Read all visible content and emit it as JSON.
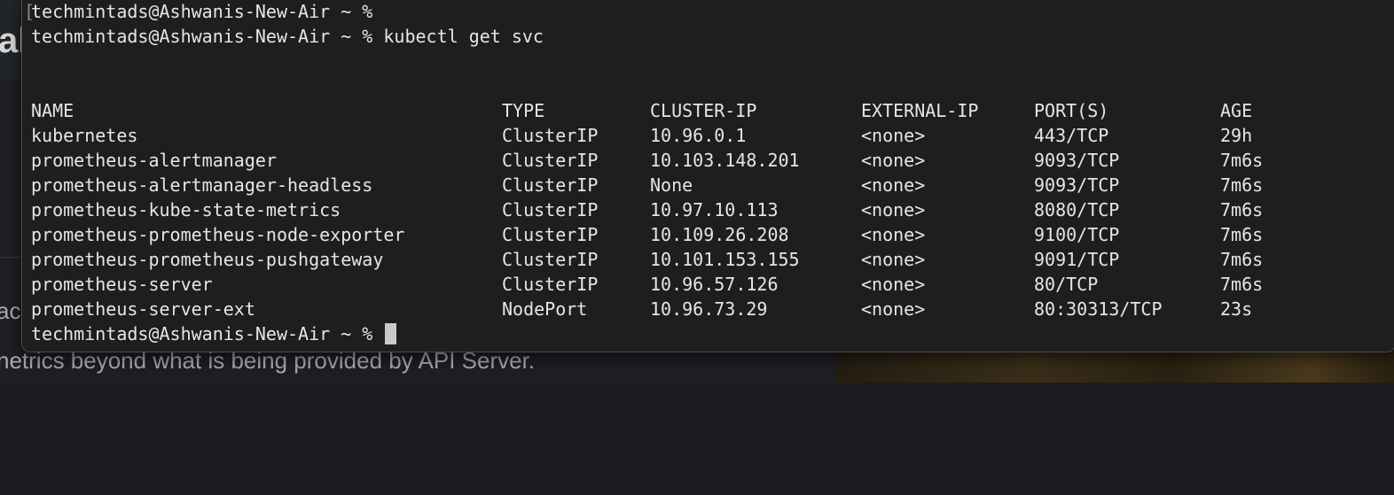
{
  "background": {
    "heading_fragment": "al",
    "text_fragment_1": "ac",
    "text_fragment_2": "netrics beyond what is being provided by API Server."
  },
  "terminal": {
    "bracket": "[",
    "prompt": "techmintads@Ashwanis-New-Air ~ %",
    "command": "kubectl get svc",
    "headers": {
      "name": "NAME",
      "type": "TYPE",
      "cluster_ip": "CLUSTER-IP",
      "external_ip": "EXTERNAL-IP",
      "ports": "PORT(S)",
      "age": "AGE"
    },
    "rows": [
      {
        "name": "kubernetes",
        "type": "ClusterIP",
        "cluster_ip": "10.96.0.1",
        "external_ip": "<none>",
        "ports": "443/TCP",
        "age": "29h"
      },
      {
        "name": "prometheus-alertmanager",
        "type": "ClusterIP",
        "cluster_ip": "10.103.148.201",
        "external_ip": "<none>",
        "ports": "9093/TCP",
        "age": "7m6s"
      },
      {
        "name": "prometheus-alertmanager-headless",
        "type": "ClusterIP",
        "cluster_ip": "None",
        "external_ip": "<none>",
        "ports": "9093/TCP",
        "age": "7m6s"
      },
      {
        "name": "prometheus-kube-state-metrics",
        "type": "ClusterIP",
        "cluster_ip": "10.97.10.113",
        "external_ip": "<none>",
        "ports": "8080/TCP",
        "age": "7m6s"
      },
      {
        "name": "prometheus-prometheus-node-exporter",
        "type": "ClusterIP",
        "cluster_ip": "10.109.26.208",
        "external_ip": "<none>",
        "ports": "9100/TCP",
        "age": "7m6s"
      },
      {
        "name": "prometheus-prometheus-pushgateway",
        "type": "ClusterIP",
        "cluster_ip": "10.101.153.155",
        "external_ip": "<none>",
        "ports": "9091/TCP",
        "age": "7m6s"
      },
      {
        "name": "prometheus-server",
        "type": "ClusterIP",
        "cluster_ip": "10.96.57.126",
        "external_ip": "<none>",
        "ports": "80/TCP",
        "age": "7m6s"
      },
      {
        "name": "prometheus-server-ext",
        "type": "NodePort",
        "cluster_ip": "10.96.73.29",
        "external_ip": "<none>",
        "ports": "80:30313/TCP",
        "age": "23s"
      }
    ]
  }
}
